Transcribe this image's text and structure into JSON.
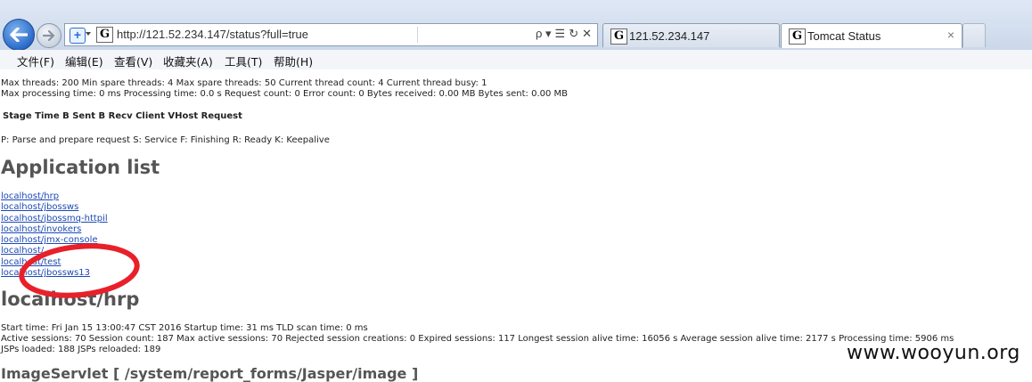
{
  "browser": {
    "url": "http://121.52.234.147/status?full=true",
    "tabs": [
      {
        "label": "121.52.234.147"
      },
      {
        "label": "Tomcat Status",
        "close": "×"
      }
    ],
    "menu": [
      "文件(F)",
      "编辑(E)",
      "查看(V)",
      "收藏夹(A)",
      "工具(T)",
      "帮助(H)"
    ],
    "addr_tools": {
      "search": "ρ ▾",
      "compat": "☰",
      "refresh": "↻",
      "stop": "✕"
    }
  },
  "page": {
    "threads_line": "Max threads: 200 Min spare threads: 4 Max spare threads: 50 Current thread count: 4 Current thread busy: 1",
    "processing_line": "Max processing time: 0 ms Processing time: 0.0 s Request count: 0 Error count: 0 Bytes received: 0.00 MB Bytes sent: 0.00 MB",
    "table_header": "Stage Time B Sent B Recv Client VHost Request",
    "legend": "P: Parse and prepare request S: Service F: Finishing R: Ready K: Keepalive",
    "app_list_heading": "Application list",
    "apps": [
      "localhost/hrp",
      "localhost/jbossws",
      "localhost/jbossmq-httpil",
      "localhost/invokers",
      "localhost/jmx-console",
      "localhost/",
      "localhost/test",
      "localhost/jbossws13"
    ],
    "hrp_heading": "localhost/hrp",
    "hrp_start": "Start time: Fri Jan 15 13:00:47 CST 2016 Startup time: 31 ms TLD scan time: 0 ms",
    "hrp_sessions": "Active sessions: 70 Session count: 187 Max active sessions: 70 Rejected session creations: 0 Expired sessions: 117 Longest session alive time: 16056 s Average session alive time: 2177 s Processing time: 5906 ms",
    "hrp_jsps": "JSPs loaded: 188 JSPs reloaded: 189",
    "servlet_heading": "ImageServlet [ /system/report_forms/Jasper/image ]"
  },
  "watermark": "www.wooyun.org",
  "colors": {
    "link": "#1c49b3",
    "annotation": "#e8202a",
    "heading": "#555555"
  }
}
